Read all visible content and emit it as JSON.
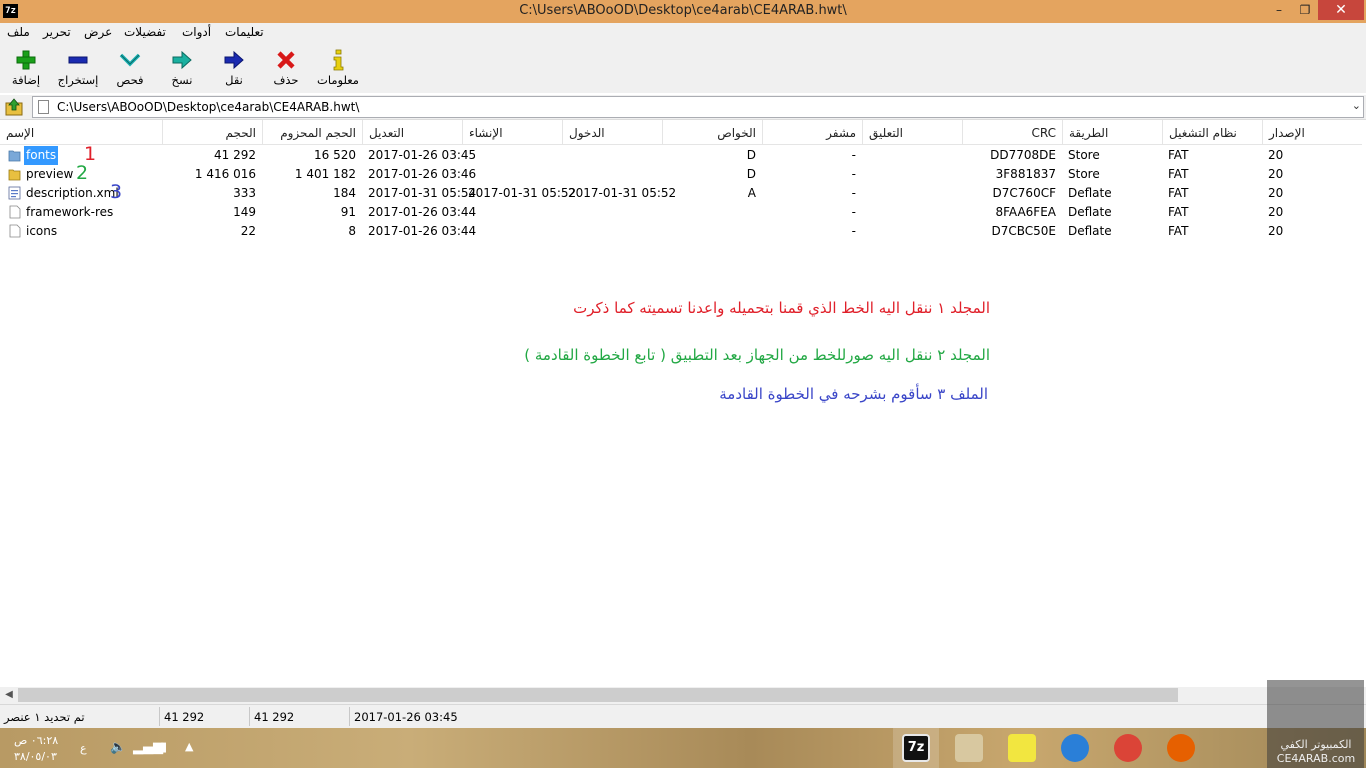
{
  "window": {
    "title": "C:\\Users\\ABOoOD\\Desktop\\ce4arab\\CE4ARAB.hwt\\",
    "app_icon_text": "7z",
    "minimize": "–",
    "maximize": "❐",
    "close": "✕"
  },
  "menu": [
    "ملف",
    "تحرير",
    "عرض",
    "تفضيلات",
    "أدوات",
    "تعليمات"
  ],
  "toolbar": [
    {
      "label": "إضافة",
      "icon": "plus-icon"
    },
    {
      "label": "إستخراج",
      "icon": "minus-icon"
    },
    {
      "label": "فحص",
      "icon": "check-arrow-icon"
    },
    {
      "label": "نسخ",
      "icon": "copy-arrow-icon"
    },
    {
      "label": "نقل",
      "icon": "move-arrow-icon"
    },
    {
      "label": "حذف",
      "icon": "delete-x-icon"
    },
    {
      "label": "معلومات",
      "icon": "info-icon"
    }
  ],
  "address": {
    "path": "C:\\Users\\ABOoOD\\Desktop\\ce4arab\\CE4ARAB.hwt\\"
  },
  "columns": [
    "الإسم",
    "الحجم",
    "الحجم المحزوم",
    "التعديل",
    "الإنشاء",
    "الدخول",
    "الخواص",
    "مشفر",
    "التعليق",
    "CRC",
    "الطريقة",
    "نظام التشغيل",
    "الإصدار"
  ],
  "files": [
    {
      "name": "fonts",
      "type": "folder",
      "size": "41 292",
      "packed": "16 520",
      "modified": "2017-01-26 03:45",
      "created": "",
      "accessed": "",
      "attr": "D",
      "enc": "-",
      "comment": "",
      "crc": "DD7708DE",
      "method": "Store",
      "os": "FAT",
      "version": "20",
      "selected": true,
      "marker": "1"
    },
    {
      "name": "preview",
      "type": "folder",
      "size": "1 416 016",
      "packed": "1 401 182",
      "modified": "2017-01-26 03:46",
      "created": "",
      "accessed": "",
      "attr": "D",
      "enc": "-",
      "comment": "",
      "crc": "3F881837",
      "method": "Store",
      "os": "FAT",
      "version": "20",
      "selected": false,
      "marker": "2"
    },
    {
      "name": "description.xml",
      "type": "xml",
      "size": "333",
      "packed": "184",
      "modified": "2017-01-31 05:54",
      "created": "2017-01-31 05:52",
      "accessed": "2017-01-31 05:52",
      "attr": "A",
      "enc": "-",
      "comment": "",
      "crc": "D7C760CF",
      "method": "Deflate",
      "os": "FAT",
      "version": "20",
      "selected": false,
      "marker": "3"
    },
    {
      "name": "framework-res",
      "type": "file",
      "size": "149",
      "packed": "91",
      "modified": "2017-01-26 03:44",
      "created": "",
      "accessed": "",
      "attr": "",
      "enc": "-",
      "comment": "",
      "crc": "8FAA6FEA",
      "method": "Deflate",
      "os": "FAT",
      "version": "20",
      "selected": false,
      "marker": ""
    },
    {
      "name": "icons",
      "type": "file",
      "size": "22",
      "packed": "8",
      "modified": "2017-01-26 03:44",
      "created": "",
      "accessed": "",
      "attr": "",
      "enc": "-",
      "comment": "",
      "crc": "D7CBC50E",
      "method": "Deflate",
      "os": "FAT",
      "version": "20",
      "selected": false,
      "marker": ""
    }
  ],
  "marker_colors": {
    "1": "#e0202a",
    "2": "#22a844",
    "3": "#3a46c8"
  },
  "annotations": [
    {
      "text": "المجلد ١ ننقل اليه الخط الذي قمنا بتحميله واعدنا تسميته كما ذكرت",
      "color": "#e0202a"
    },
    {
      "text": "المجلد ٢ ننقل اليه صورللخط من الجهاز بعد التطبيق ( تابع الخطوة القادمة )",
      "color": "#22a844"
    },
    {
      "text": "الملف ٣ سأقوم بشرحه في الخطوة القادمة",
      "color": "#3a46c8"
    }
  ],
  "status": {
    "selection": "تم تحديد ١ عنصر",
    "size": "41 292",
    "packed": "41 292",
    "date": "2017-01-26 03:45"
  },
  "taskbar": {
    "time": "٠٦:٢٨ ص",
    "date": "٣٨/٠٥/٠٣",
    "lang": "ع",
    "apps": [
      {
        "name": "7z",
        "icon": "7zip-icon",
        "color": "#e8e8e8"
      },
      {
        "name": "paint",
        "icon": "paint-icon",
        "color": "#d8c8a0"
      },
      {
        "name": "media",
        "icon": "media-player-icon",
        "color": "#f2e640"
      },
      {
        "name": "shareit",
        "icon": "shareit-icon",
        "color": "#2a7fd8"
      },
      {
        "name": "chrome",
        "icon": "chrome-icon",
        "color": "#db4437"
      },
      {
        "name": "firefox",
        "icon": "firefox-icon",
        "color": "#e66000"
      }
    ],
    "watermark_1": "الكمبيوتر الكفي",
    "watermark_2": "CE4ARAB.com"
  }
}
